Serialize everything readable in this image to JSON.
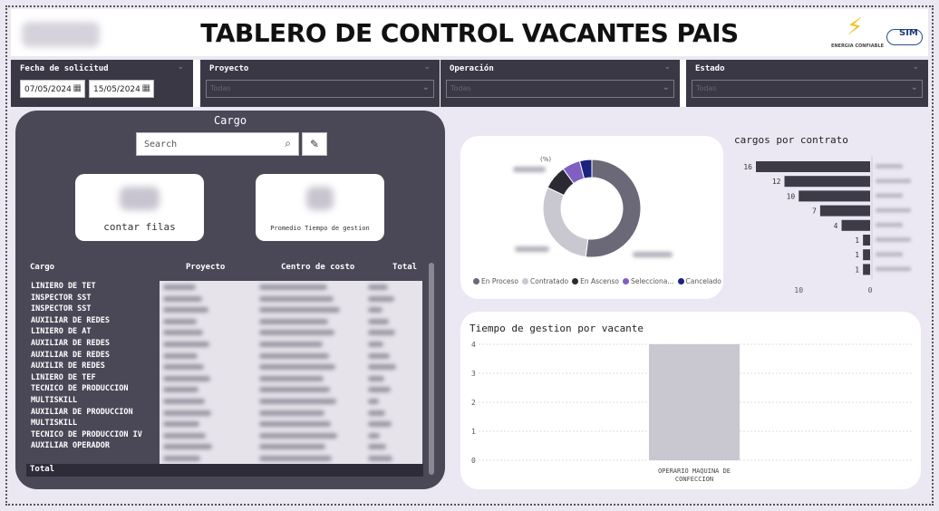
{
  "header": {
    "title": "TABLERO DE CONTROL VACANTES PAIS",
    "energy_logo_caption": "ENERGIA CONFIABLE",
    "sim_logo_text": "SIM"
  },
  "filters": {
    "fecha": {
      "label": "Fecha de solicitud",
      "start": "07/05/2024",
      "end": "15/05/2024"
    },
    "proyecto": {
      "label": "Proyecto",
      "value": "Todas"
    },
    "operacion": {
      "label": "Operación",
      "value": "Todas"
    },
    "estado": {
      "label": "Estado",
      "value": "Todas"
    }
  },
  "left": {
    "title": "Cargo",
    "search_placeholder": "Search",
    "card1_caption": "contar filas",
    "card2_caption": "Promedio Tiempo de gestion",
    "table": {
      "headers": [
        "Cargo",
        "Proyecto",
        "Centro de costo",
        "Total"
      ],
      "rows": [
        "LINIERO DE TET",
        "INSPECTOR SST",
        "INSPECTOR SST",
        "AUXILIAR DE REDES",
        "LINIERO DE AT",
        "AUXILIAR DE REDES",
        "AUXILIAR DE REDES",
        "AUXILIR DE REDES",
        "LINIERO DE TEF",
        "TECNICO DE PRODUCCION MULTISKILL",
        "AUXILIAR DE PRODUCCION MULTISKILL",
        "TECNICO DE PRODUCCION IV",
        "AUXILIAR OPERADOR"
      ],
      "total_label": "Total"
    }
  },
  "donut": {
    "percent_label": "(%)",
    "legend": [
      {
        "label": "En Proceso",
        "color": "#6b6878"
      },
      {
        "label": "Contratado",
        "color": "#c9c7d0"
      },
      {
        "label": "En Ascenso",
        "color": "#2b2a33"
      },
      {
        "label": "Selecciona...",
        "color": "#7f5fc2"
      },
      {
        "label": "Cancelado",
        "color": "#1a237e"
      }
    ]
  },
  "chart_data": [
    {
      "type": "pie",
      "title": "",
      "categories": [
        "En Proceso",
        "Contratado",
        "En Ascenso",
        "Selecciona...",
        "Cancelado"
      ],
      "values": [
        52,
        30,
        8,
        6,
        4
      ]
    },
    {
      "type": "bar",
      "title": "cargos por contrato",
      "orientation": "horizontal",
      "values": [
        16,
        12,
        10,
        7,
        4,
        1,
        1,
        1
      ],
      "xticks": [
        "10",
        "0"
      ],
      "xlim": [
        0,
        16
      ],
      "color": "#3d3b48"
    },
    {
      "type": "bar",
      "title": "Tiempo de gestion por vacante",
      "categories": [
        "OPERARIO MAQUINA DE CONFECCION"
      ],
      "values": [
        4
      ],
      "ylim": [
        0,
        4
      ],
      "yticks": [
        "4",
        "3",
        "2",
        "1",
        "0"
      ],
      "color": "#c9c7d0"
    }
  ]
}
